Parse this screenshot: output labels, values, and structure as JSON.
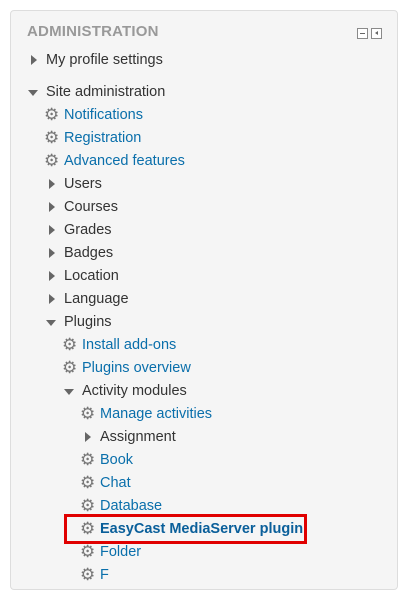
{
  "block": {
    "title": "ADMINISTRATION",
    "controls": {
      "hide_icon": "hide-block-icon",
      "dock_icon": "dock-block-icon"
    }
  },
  "tree": {
    "my_profile": "My profile settings",
    "site_admin": "Site administration",
    "notifications": "Notifications",
    "registration": "Registration",
    "advanced_features": "Advanced features",
    "users": "Users",
    "courses": "Courses",
    "grades": "Grades",
    "badges": "Badges",
    "location": "Location",
    "language": "Language",
    "plugins": "Plugins",
    "install_addons": "Install add-ons",
    "plugins_overview": "Plugins overview",
    "activity_modules": "Activity modules",
    "manage_activities": "Manage activities",
    "assignment": "Assignment",
    "book": "Book",
    "chat": "Chat",
    "database": "Database",
    "easycast": "EasyCast MediaServer plugin",
    "folder": "Folder",
    "forum_partial": "F"
  },
  "colors": {
    "link": "#0a6fab",
    "highlight": "#e00000",
    "block_bg": "#f5f5f5"
  }
}
